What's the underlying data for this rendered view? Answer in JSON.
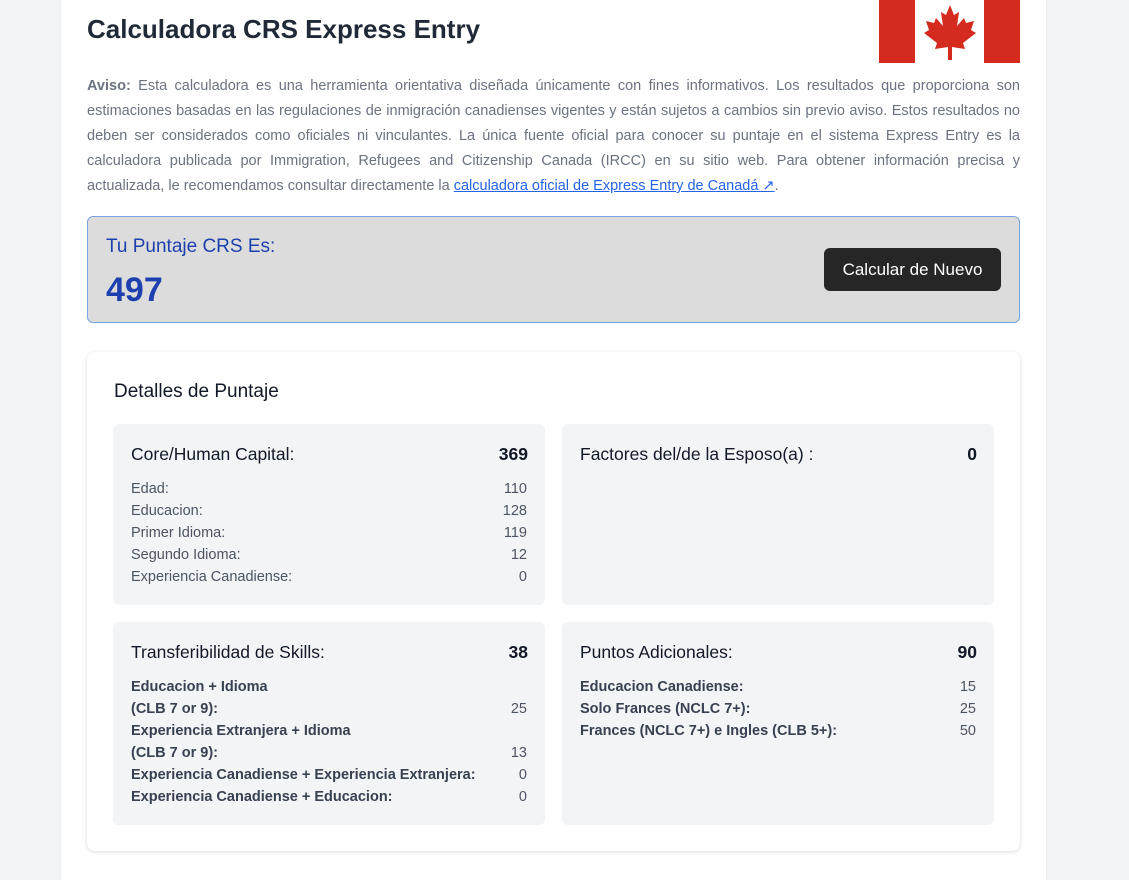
{
  "header": {
    "title": "Calculadora CRS Express Entry"
  },
  "disclaimer": {
    "label": "Aviso:",
    "text": " Esta calculadora es una herramienta orientativa diseñada únicamente con fines informativos. Los resultados que proporciona son estimaciones basadas en las regulaciones de inmigración canadienses vigentes y están sujetos a cambios sin previo aviso. Estos resultados no deben ser considerados como oficiales ni vinculantes. La única fuente oficial para conocer su puntaje en el sistema Express Entry es la calculadora publicada por Immigration, Refugees and Citizenship Canada (IRCC) en su sitio web. Para obtener información precisa y actualizada, le recomendamos consultar directamente la ",
    "link_text": "calculadora oficial de Express Entry de Canadá ↗",
    "trailing": "."
  },
  "score": {
    "label": "Tu Puntaje CRS Es:",
    "value": "497",
    "button_label": "Calcular de Nuevo"
  },
  "details": {
    "title": "Detalles de Puntaje",
    "core": {
      "label": "Core/Human Capital:",
      "total": "369",
      "rows": [
        {
          "k": "Edad:",
          "v": "110"
        },
        {
          "k": "Educacion:",
          "v": "128"
        },
        {
          "k": "Primer Idioma:",
          "v": "119"
        },
        {
          "k": "Segundo Idioma:",
          "v": "12"
        },
        {
          "k": "Experiencia Canadiense:",
          "v": "0"
        }
      ]
    },
    "spouse": {
      "label": "Factores del/de la Esposo(a) :",
      "total": "0"
    },
    "transfer": {
      "label": "Transferibilidad de Skills:",
      "total": "38",
      "rows": [
        {
          "k": "Educacion + Idioma",
          "v": ""
        },
        {
          "k": "(CLB 7 or 9):",
          "v": "25"
        },
        {
          "k": "Experiencia Extranjera + Idioma",
          "v": ""
        },
        {
          "k": "(CLB 7 or 9):",
          "v": "13"
        },
        {
          "k": "Experiencia Canadiense + Experiencia Extranjera:",
          "v": "0"
        },
        {
          "k": "Experiencia Canadiense + Educacion:",
          "v": "0"
        }
      ]
    },
    "additional": {
      "label": "Puntos Adicionales:",
      "total": "90",
      "rows": [
        {
          "k": "Educacion Canadiense:",
          "v": "15"
        },
        {
          "k": "Solo Frances (NCLC 7+):",
          "v": "25"
        },
        {
          "k": "Frances (NCLC 7+) e Ingles (CLB 5+):",
          "v": "50"
        }
      ]
    }
  },
  "colors": {
    "accent": "#1e40af",
    "link": "#2563eb",
    "flag_red": "#d52b1e",
    "button_bg": "#262626"
  },
  "icons": {
    "flag": "canada-flag-icon",
    "external_link": "external-link-icon"
  }
}
